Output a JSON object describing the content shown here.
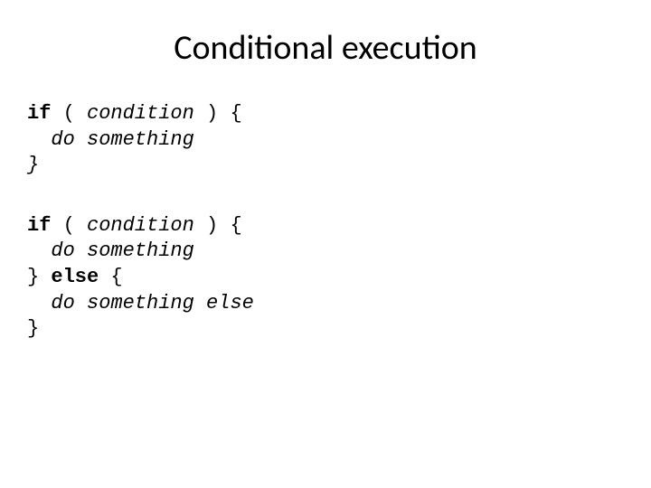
{
  "title": "Conditional execution",
  "block1": {
    "l1_kw": "if",
    "l1_open": " ( ",
    "l1_cond": "condition",
    "l1_close": " ) {",
    "l2_indent": "  ",
    "l2_body": "do something",
    "l3": "}"
  },
  "block2": {
    "l1_kw": "if",
    "l1_open": " ( ",
    "l1_cond": "condition",
    "l1_close": " ) {",
    "l2_indent": "  ",
    "l2_body": "do something",
    "l3_close": "} ",
    "l3_kw": "else",
    "l3_open": " {",
    "l4_indent": "  ",
    "l4_body": "do something else",
    "l5": "}"
  }
}
